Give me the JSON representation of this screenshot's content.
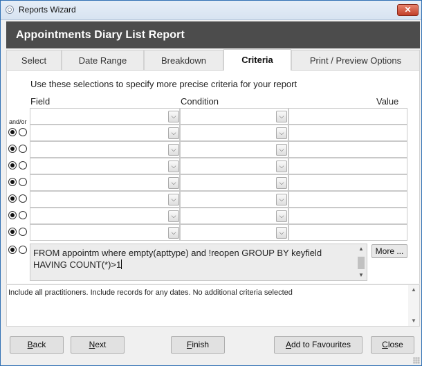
{
  "window": {
    "title": "Reports Wizard",
    "close_glyph": "✕",
    "close_icon": "close-icon"
  },
  "header": {
    "title": "Appointments Diary List Report"
  },
  "tabs": [
    {
      "label": "Select"
    },
    {
      "label": "Date Range"
    },
    {
      "label": "Breakdown"
    },
    {
      "label": "Criteria",
      "active": true
    },
    {
      "label": "Print / Preview Options"
    }
  ],
  "criteria": {
    "intro": "Use these selections to specify more precise criteria for your report",
    "headers": {
      "field": "Field",
      "condition": "Condition",
      "value": "Value"
    },
    "andor_label": "and/or",
    "rows": [
      {
        "field": "",
        "condition": "",
        "value": "",
        "radio_and": false,
        "radio_or": true
      },
      {
        "field": "",
        "condition": "",
        "value": "",
        "radio_and": true,
        "radio_or": false
      },
      {
        "field": "",
        "condition": "",
        "value": "",
        "radio_and": true,
        "radio_or": false
      },
      {
        "field": "",
        "condition": "",
        "value": "",
        "radio_and": true,
        "radio_or": false
      },
      {
        "field": "",
        "condition": "",
        "value": "",
        "radio_and": true,
        "radio_or": false
      },
      {
        "field": "",
        "condition": "",
        "value": "",
        "radio_and": true,
        "radio_or": false
      },
      {
        "field": "",
        "condition": "",
        "value": "",
        "radio_and": true,
        "radio_or": false
      },
      {
        "field": "",
        "condition": "",
        "value": "",
        "radio_and": true,
        "radio_or": false
      }
    ],
    "sql_text": "FROM appointm where empty(apttype) and !reopen GROUP BY keyfield HAVING COUNT(*)>1",
    "more_label": "More ..."
  },
  "summary": {
    "text": "Include all practitioners. Include records for any dates. No additional criteria selected"
  },
  "buttons": {
    "back": {
      "mnemonic": "B",
      "rest": "ack"
    },
    "next": {
      "mnemonic": "N",
      "rest": "ext"
    },
    "finish": {
      "mnemonic": "F",
      "rest": "inish"
    },
    "favourites": {
      "mnemonic": "A",
      "rest": "dd to Favourites"
    },
    "close": {
      "mnemonic": "C",
      "rest": "lose"
    }
  },
  "colors": {
    "header_bg": "#4c4c4c",
    "close_button": "#c2402a",
    "border": "#2f6fb3"
  }
}
